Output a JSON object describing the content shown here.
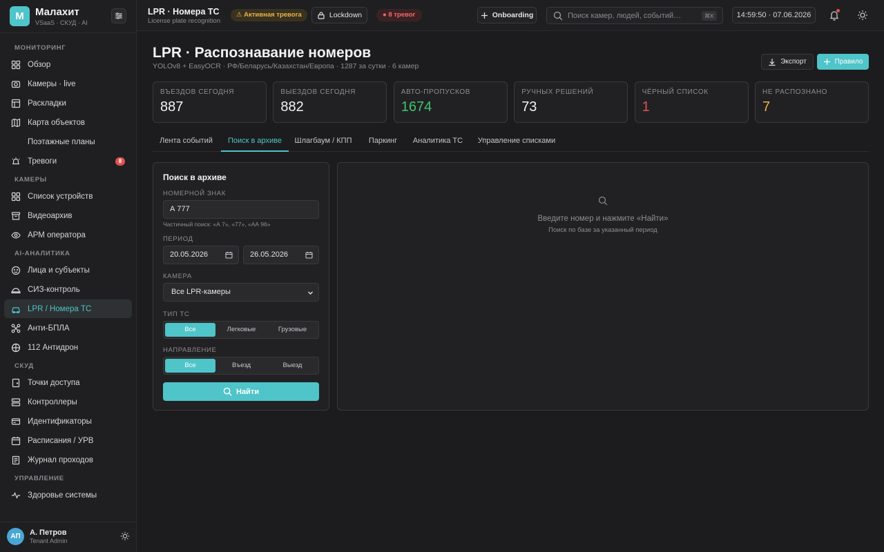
{
  "brand": {
    "logo": "М",
    "name": "Малахит",
    "sub": "VSaaS · СКУД · AI"
  },
  "sidebar": {
    "sections": [
      {
        "title": "МОНИТОРИНГ",
        "items": [
          {
            "label": "Обзор",
            "icon": "grid-icon"
          },
          {
            "label": "Камеры · live",
            "icon": "camera-icon"
          },
          {
            "label": "Раскладки",
            "icon": "layout-icon"
          },
          {
            "label": "Карта объектов",
            "icon": "map-icon"
          },
          {
            "label": "Поэтажные планы",
            "icon": "",
            "sub": true
          },
          {
            "label": "Тревоги",
            "icon": "alarm-icon",
            "badge": "8"
          }
        ]
      },
      {
        "title": "КАМЕРЫ",
        "items": [
          {
            "label": "Список устройств",
            "icon": "grid-icon"
          },
          {
            "label": "Видеоархив",
            "icon": "archive-icon"
          },
          {
            "label": "АРМ оператора",
            "icon": "eye-icon"
          }
        ]
      },
      {
        "title": "AI-АНАЛИТИКА",
        "items": [
          {
            "label": "Лица и субъекты",
            "icon": "face-icon"
          },
          {
            "label": "СИЗ-контроль",
            "icon": "helmet-icon"
          },
          {
            "label": "LPR / Номера ТС",
            "icon": "car-icon",
            "active": true
          },
          {
            "label": "Анти-БПЛА",
            "icon": "drone-icon"
          },
          {
            "label": "112 Антидрон",
            "icon": "radar-icon"
          }
        ]
      },
      {
        "title": "СКУД",
        "items": [
          {
            "label": "Точки доступа",
            "icon": "door-icon"
          },
          {
            "label": "Контроллеры",
            "icon": "server-icon"
          },
          {
            "label": "Идентификаторы",
            "icon": "card-icon"
          },
          {
            "label": "Расписания / УРВ",
            "icon": "calendar-icon"
          },
          {
            "label": "Журнал проходов",
            "icon": "log-icon"
          }
        ]
      },
      {
        "title": "УПРАВЛЕНИЕ",
        "items": [
          {
            "label": "Здоровье системы",
            "icon": "pulse-icon"
          }
        ]
      }
    ]
  },
  "user": {
    "initials": "АП",
    "name": "А. Петров",
    "role": "Tenant Admin"
  },
  "header": {
    "title": "LPR · Номера ТС",
    "subtitle": "License plate recognition",
    "alarm_pill": "⚠ Активная тревога",
    "lockdown_label": "Lockdown",
    "alerts_pill": "● 8 тревог",
    "onboarding_label": "Onboarding",
    "search_placeholder": "Поиск камер, людей, событий…",
    "search_kbd": "⌘K",
    "clock": "14:59:50 · 07.06.2026"
  },
  "page": {
    "title": "LPR · Распознавание номеров",
    "subtitle": "YOLOv8 + EasyOCR · РФ/Беларусь/Казахстан/Европа · 1287 за сутки · 6 камер",
    "export_label": "Экспорт",
    "rule_label": "Правило"
  },
  "stats": [
    {
      "label": "ВЪЕЗДОВ СЕГОДНЯ",
      "value": "887",
      "color": "#f2f2f4"
    },
    {
      "label": "ВЫЕЗДОВ СЕГОДНЯ",
      "value": "882",
      "color": "#f2f2f4"
    },
    {
      "label": "АВТО-ПРОПУСКОВ",
      "value": "1674",
      "color": "#3ec46d"
    },
    {
      "label": "РУЧНЫХ РЕШЕНИЙ",
      "value": "73",
      "color": "#f2f2f4"
    },
    {
      "label": "ЧЁРНЫЙ СПИСОК",
      "value": "1",
      "color": "#e05252"
    },
    {
      "label": "НЕ РАСПОЗНАНО",
      "value": "7",
      "color": "#e8b24a"
    }
  ],
  "tabs": [
    {
      "label": "Лента событий"
    },
    {
      "label": "Поиск в архиве",
      "active": true
    },
    {
      "label": "Шлагбаум / КПП"
    },
    {
      "label": "Паркинг"
    },
    {
      "label": "Аналитика ТС"
    },
    {
      "label": "Управление списками"
    }
  ],
  "search_panel": {
    "title": "Поиск в архиве",
    "plate_label": "НОМЕРНОЙ ЗНАК",
    "plate_value": "А 777",
    "plate_hint": "Частичный поиск: «А 7», «77», «АА 96»",
    "period_label": "ПЕРИОД",
    "date_from": "20.05.2026",
    "date_to": "26.05.2026",
    "camera_label": "КАМЕРА",
    "camera_value": "Все LPR-камеры",
    "type_label": "ТИП ТС",
    "type_options": [
      "Все",
      "Легковые",
      "Грузовые"
    ],
    "direction_label": "НАПРАВЛЕНИЕ",
    "direction_options": [
      "Все",
      "Въезд",
      "Выезд"
    ],
    "find_label": "Найти"
  },
  "results": {
    "empty_title": "Введите номер и нажмите «Найти»",
    "empty_sub": "Поиск по базе за указанный период"
  },
  "colors": {
    "accent": "#4fc4c9",
    "danger": "#e05252",
    "warning": "#e8b24a",
    "success": "#3ec46d"
  }
}
